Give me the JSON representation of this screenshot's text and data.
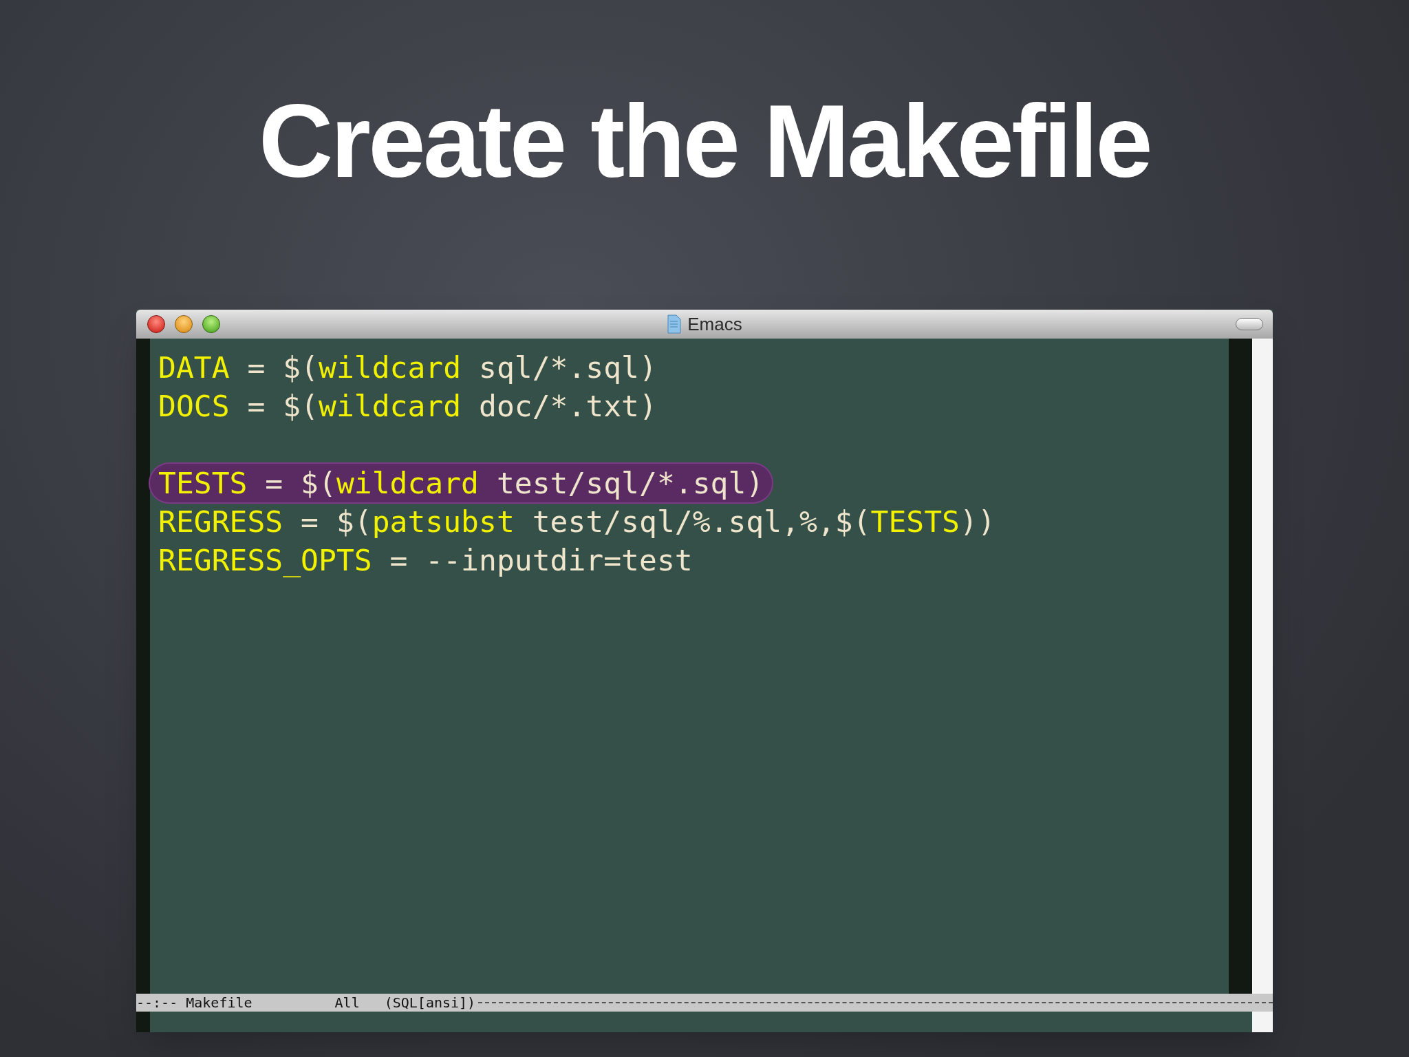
{
  "slide_title": "Create the Makefile",
  "window": {
    "title": "Emacs"
  },
  "editor": {
    "lines": [
      {
        "kind": "code",
        "highlighted": false,
        "segments": [
          {
            "kind": "name",
            "text": "DATA"
          },
          {
            "kind": "plain",
            "text": " = $("
          },
          {
            "kind": "name",
            "text": "wildcard"
          },
          {
            "kind": "plain",
            "text": " sql/*.sql)"
          }
        ]
      },
      {
        "kind": "code",
        "highlighted": false,
        "segments": [
          {
            "kind": "name",
            "text": "DOCS"
          },
          {
            "kind": "plain",
            "text": " = $("
          },
          {
            "kind": "name",
            "text": "wildcard"
          },
          {
            "kind": "plain",
            "text": " doc/*.txt)"
          }
        ]
      },
      {
        "kind": "blank"
      },
      {
        "kind": "code",
        "highlighted": true,
        "segments": [
          {
            "kind": "name",
            "text": "TESTS"
          },
          {
            "kind": "plain",
            "text": " = $("
          },
          {
            "kind": "name",
            "text": "wildcard"
          },
          {
            "kind": "plain",
            "text": " test/sql/*.sql)"
          }
        ]
      },
      {
        "kind": "code",
        "highlighted": false,
        "segments": [
          {
            "kind": "name",
            "text": "REGRESS"
          },
          {
            "kind": "plain",
            "text": " = $("
          },
          {
            "kind": "name",
            "text": "patsubst"
          },
          {
            "kind": "plain",
            "text": " test/sql/%.sql,%,$("
          },
          {
            "kind": "name",
            "text": "TESTS"
          },
          {
            "kind": "plain",
            "text": "))"
          }
        ]
      },
      {
        "kind": "code",
        "highlighted": false,
        "segments": [
          {
            "kind": "name",
            "text": "REGRESS_OPTS"
          },
          {
            "kind": "plain",
            "text": " = --inputdir=test"
          }
        ]
      }
    ]
  },
  "mode_line": {
    "status": "--:--",
    "buffer": "Makefile",
    "position": "All",
    "mode": "(SQL[ansi])"
  }
}
